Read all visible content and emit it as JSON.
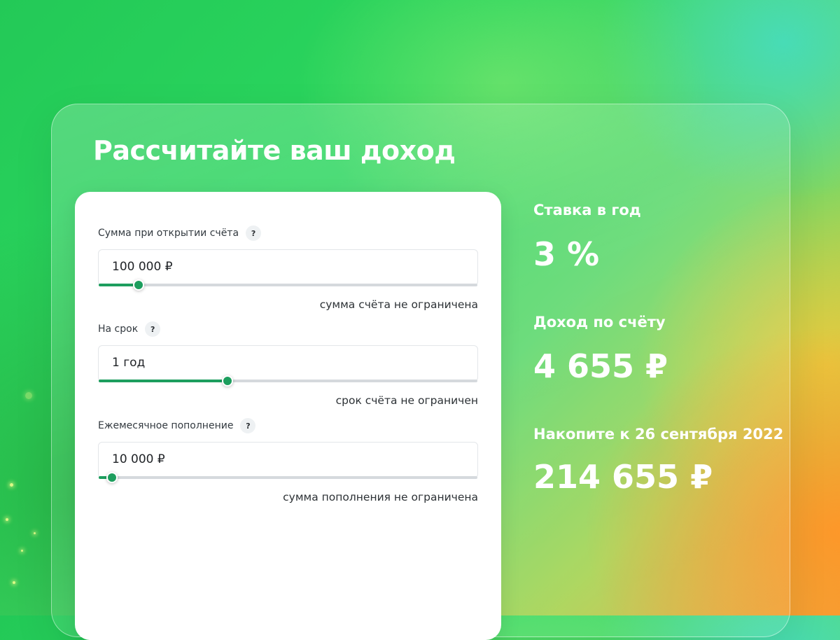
{
  "title": "Рассчитайте ваш доход",
  "calculator": {
    "fields": [
      {
        "label": "Сумма при открытии счёта",
        "help": "?",
        "value": "100 000 ₽",
        "slider_fraction": 0.105,
        "hint": "сумма счёта не ограничена"
      },
      {
        "label": "На срок",
        "help": "?",
        "value": "1 год",
        "slider_fraction": 0.34,
        "hint": "срок счёта не ограничен"
      },
      {
        "label": "Ежемесячное пополнение",
        "help": "?",
        "value": "10 000 ₽",
        "slider_fraction": 0.035,
        "hint": "сумма пополнения не ограничена"
      }
    ]
  },
  "results": {
    "rate_label": "Ставка в год",
    "rate_value": "3 %",
    "income_label": "Доход по счёту",
    "income_value": "4 655 ₽",
    "accumulate_label": "Накопите к 26 сентября 2022",
    "accumulate_value": "214 655 ₽"
  },
  "colors": {
    "accent": "#1d9e5e",
    "text_on_green": "#ffffff"
  }
}
